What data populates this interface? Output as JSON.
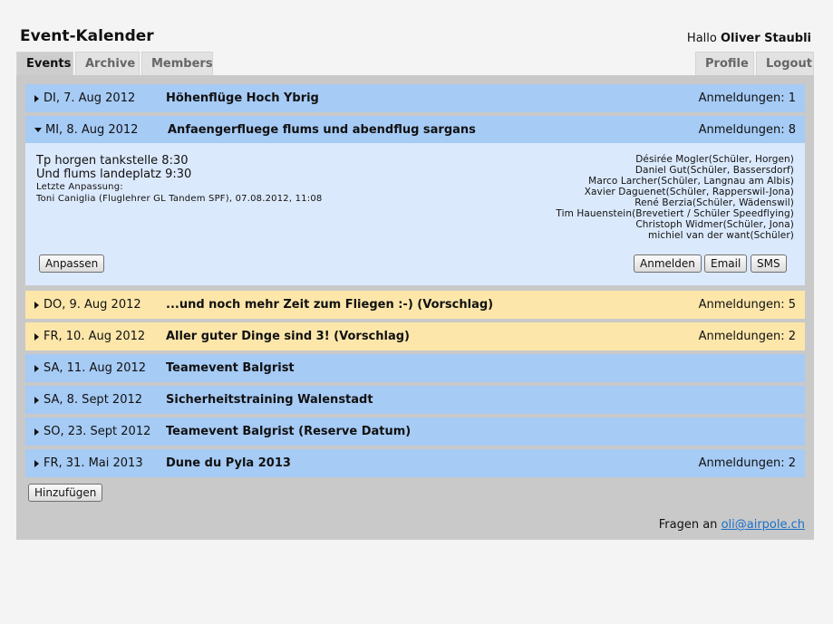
{
  "app": {
    "title": "Event-Kalender"
  },
  "user": {
    "greeting": "Hallo",
    "name": "Oliver Staubli"
  },
  "tabs": {
    "events": "Events",
    "archive": "Archive",
    "members": "Members",
    "profile": "Profile",
    "logout": "Logout"
  },
  "events": [
    {
      "date": "DI, 7. Aug 2012",
      "title": "Höhenflüge Hoch Ybrig",
      "registrations": "Anmeldungen: 1",
      "color": "blue"
    },
    {
      "date": "MI, 8. Aug 2012",
      "title": "Anfaengerfluege flums und abendflug sargans",
      "registrations": "Anmeldungen: 8",
      "color": "blue",
      "expanded": true
    },
    {
      "date": "DO, 9. Aug 2012",
      "title": "...und noch mehr Zeit zum Fliegen :-) (Vorschlag)",
      "registrations": "Anmeldungen: 5",
      "color": "yellow"
    },
    {
      "date": "FR, 10. Aug 2012",
      "title": "Aller guter Dinge sind 3! (Vorschlag)",
      "registrations": "Anmeldungen: 2",
      "color": "yellow"
    },
    {
      "date": "SA, 11. Aug 2012",
      "title": "Teamevent Balgrist",
      "registrations": "",
      "color": "blue"
    },
    {
      "date": "SA, 8. Sept 2012",
      "title": "Sicherheitstraining Walenstadt",
      "registrations": "",
      "color": "blue"
    },
    {
      "date": "SO, 23. Sept 2012",
      "title": "Teamevent Balgrist (Reserve Datum)",
      "registrations": "",
      "color": "blue"
    },
    {
      "date": "FR, 31. Mai 2013",
      "title": "Dune du Pyla 2013",
      "registrations": "Anmeldungen: 2",
      "color": "blue"
    }
  ],
  "detail": {
    "description_line1": "Tp horgen tankstelle 8:30",
    "description_line2": "Und flums landeplatz 9:30",
    "last_modified_label": "Letzte Anpassung:",
    "last_modified_info": "Toni Caniglia (Fluglehrer GL Tandem SPF), 07.08.2012, 11:08",
    "participants": [
      "Désirée Mogler(Schüler, Horgen)",
      "Daniel Gut(Schüler, Bassersdorf)",
      "Marco Larcher(Schüler, Langnau am Albis)",
      "Xavier Daguenet(Schüler, Rapperswil-Jona)",
      "René Berzia(Schüler, Wädenswil)",
      "Tim Hauenstein(Brevetiert / Schüler Speedflying)",
      "Christoph Widmer(Schüler, Jona)",
      "michiel van der want(Schüler)"
    ],
    "buttons": {
      "edit": "Anpassen",
      "register": "Anmelden",
      "email": "Email",
      "sms": "SMS"
    }
  },
  "add_button": "Hinzufügen",
  "footer": {
    "question": "Fragen an",
    "email": "oli@airpole.ch"
  },
  "colors": {
    "blue_row": "#a6cbf5",
    "yellow_row": "#fce6aa",
    "detail_bg": "#dbe9fc",
    "panel_bg": "#c9c9c9",
    "link": "#1a6fc9"
  }
}
